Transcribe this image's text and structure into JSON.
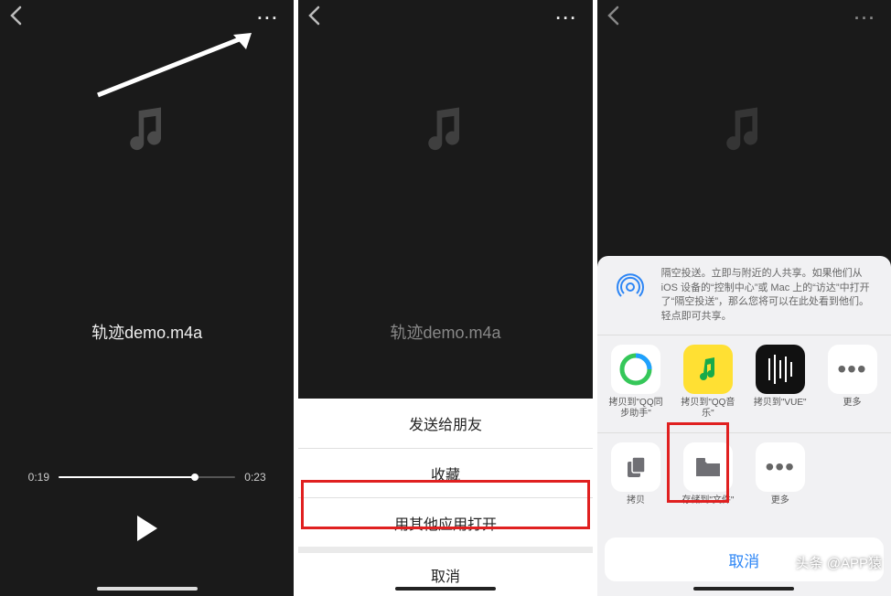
{
  "screen1": {
    "filename": "轨迹demo.m4a",
    "time_current": "0:19",
    "time_total": "0:23",
    "progress_pct": 77
  },
  "screen2": {
    "filename": "轨迹demo.m4a",
    "menu": {
      "send": "发送给朋友",
      "fav": "收藏",
      "other": "用其他应用打开",
      "cancel": "取消"
    }
  },
  "screen3": {
    "airdrop_text": "隔空投送。立即与附近的人共享。如果他们从 iOS 设备的“控制中心”或 Mac 上的“访达”中打开了“隔空投送”，那么您将可以在此处看到他们。轻点即可共享。",
    "apps_row1": {
      "qq_sync": "拷贝到\"QQ同步助手\"",
      "qq_music": "拷贝到\"QQ音乐\"",
      "vue": "拷贝到\"VUE\"",
      "more": "更多"
    },
    "apps_row2": {
      "copy": "拷贝",
      "save_files": "存储到\"文件\"",
      "more": "更多"
    },
    "cancel": "取消"
  },
  "byline": "头条 @APP猿"
}
